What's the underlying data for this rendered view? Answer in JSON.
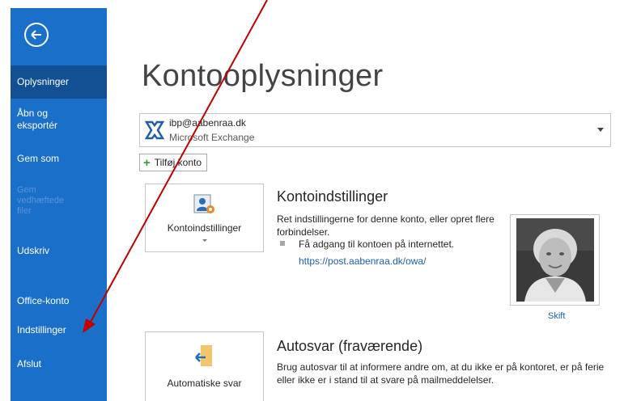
{
  "sidebar": {
    "back_icon": "back-arrow-circle-icon",
    "items": [
      {
        "label": "Oplysninger",
        "active": true
      },
      {
        "label": "Åbn og\neksportér"
      },
      {
        "label": "Gem som"
      },
      {
        "label": "Gem\nvedhæftede\nfiler",
        "disabled": true
      },
      {
        "label": "Udskriv"
      },
      {
        "label": "Office-konto"
      },
      {
        "label": "Indstillinger"
      },
      {
        "label": "Afslut"
      }
    ]
  },
  "main": {
    "title": "Kontooplysninger",
    "account": {
      "email": "ibp@aabenraa.dk",
      "type": "Microsoft Exchange",
      "icon": "exchange-icon"
    },
    "add_account_label": "Tilføj konto",
    "account_settings": {
      "tile_label": "Kontoindstillinger",
      "title": "Kontoindstillinger",
      "description": "Ret indstillingerne for denne konto, eller opret flere forbindelser.",
      "bullet": "Få adgang til kontoen på internettet.",
      "link": "https://post.aabenraa.dk/owa/"
    },
    "profile": {
      "change_label": "Skift"
    },
    "auto_reply": {
      "tile_label": "Automatiske svar",
      "title": "Autosvar (fraværende)",
      "description": "Brug autosvar til at informere andre om, at du ikke er på kontoret, er på ferie eller ikke er i stand til at svare på mailmeddelelser."
    }
  },
  "colors": {
    "sidebar": "#1a6fc9",
    "sidebar_active": "#124f93",
    "annotation_arrow": "#c00000",
    "link": "#1a5fb4"
  }
}
